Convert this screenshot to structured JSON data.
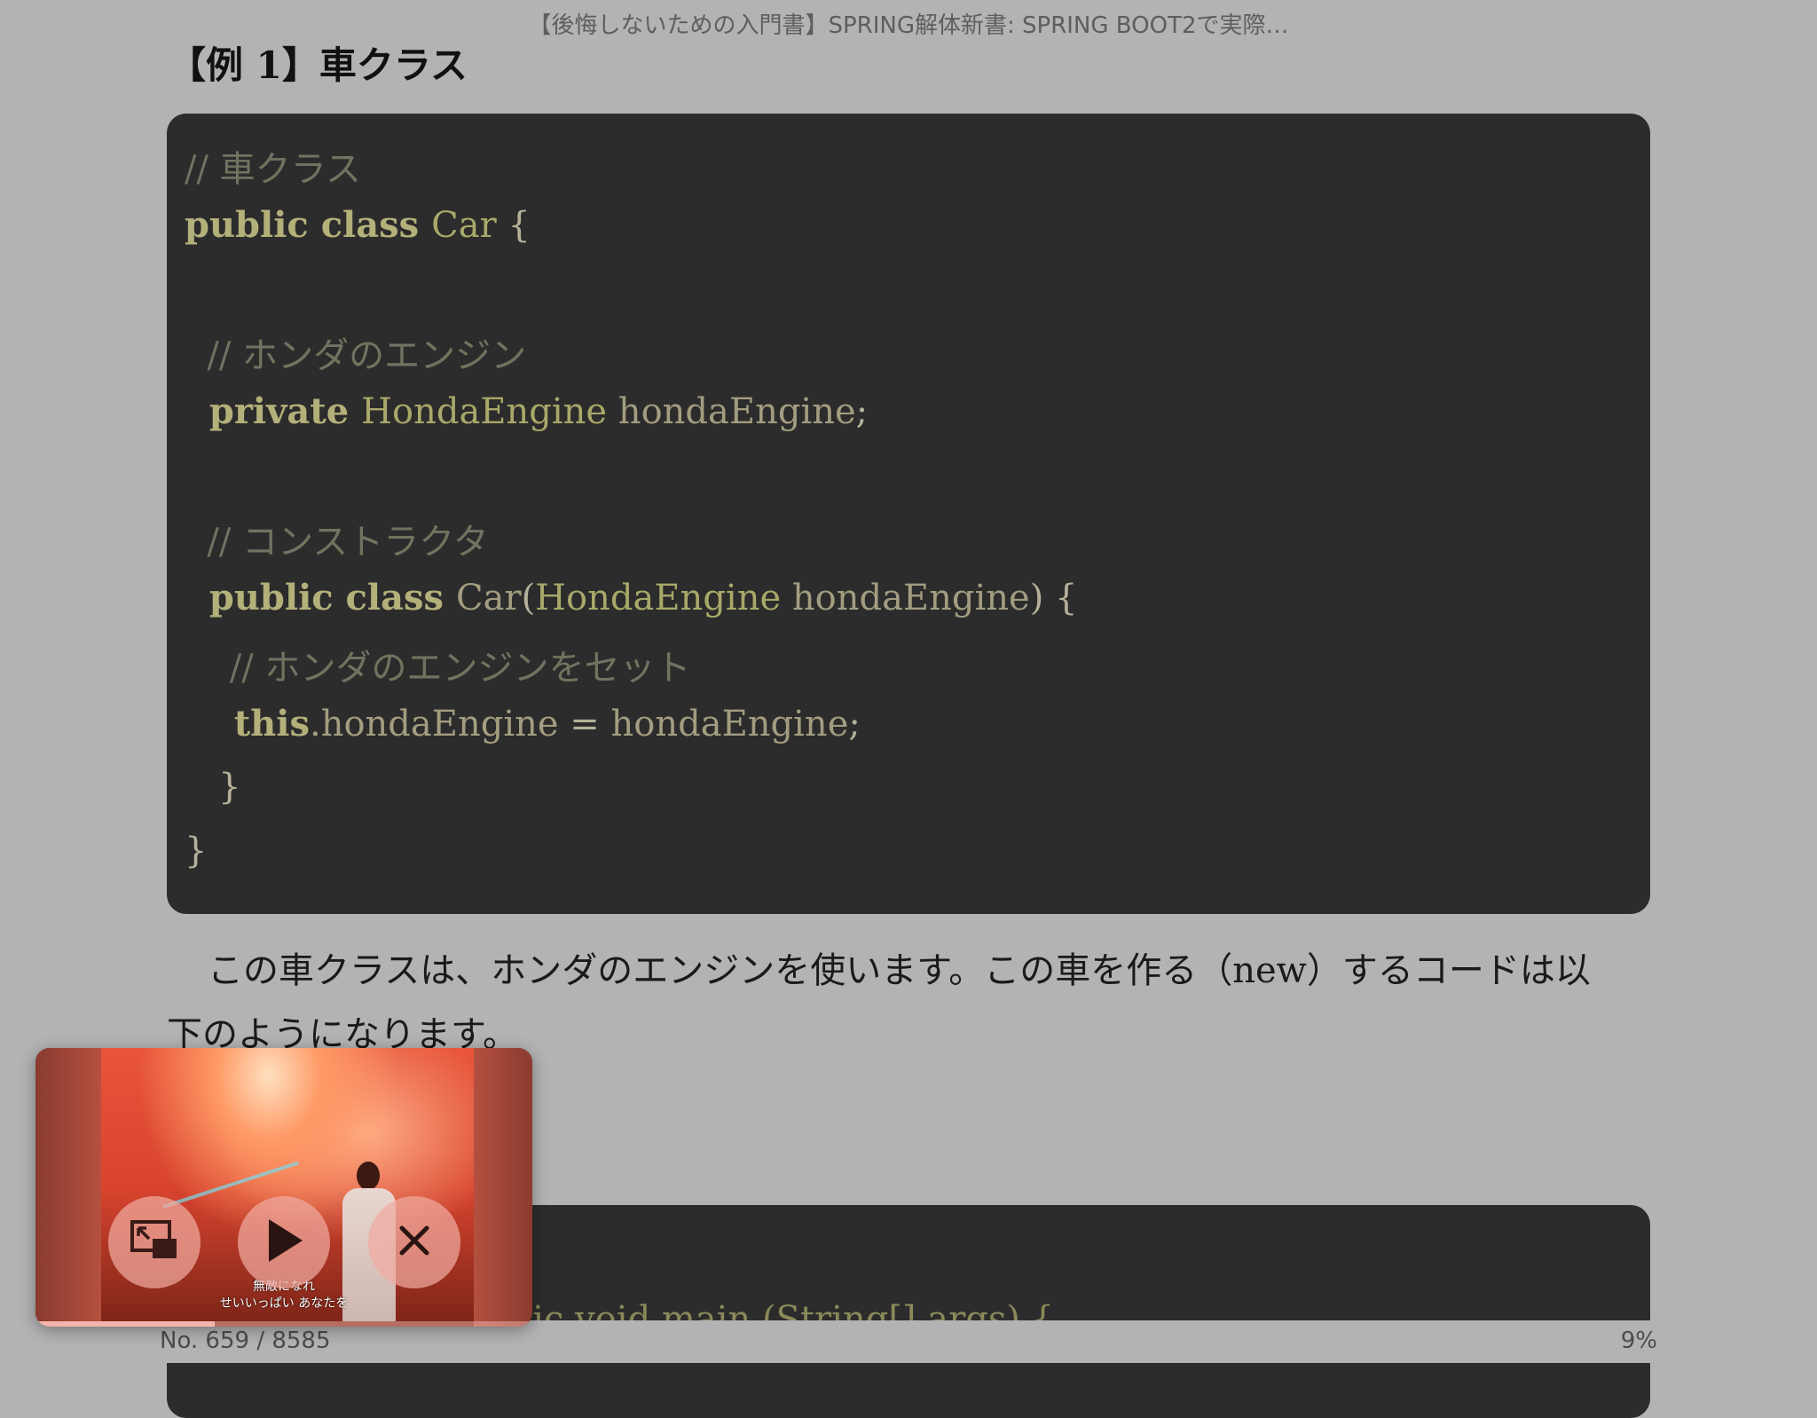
{
  "header": {
    "book_title": "【後悔しないための入門書】SPRING解体新書: SPRING BOOT2で実際…"
  },
  "section": {
    "heading": "【例 1】車クラス"
  },
  "code_block": {
    "lines": [
      [
        {
          "t": "// 車クラス",
          "c": "comment"
        }
      ],
      [
        {
          "t": "public class ",
          "c": "kw"
        },
        {
          "t": "Car",
          "c": "type"
        },
        {
          "t": " {",
          "c": "punc"
        }
      ],
      [],
      [
        {
          "t": "  // ホンダのエンジン",
          "c": "comment"
        }
      ],
      [
        {
          "t": "  private ",
          "c": "kw"
        },
        {
          "t": "HondaEngine",
          "c": "type"
        },
        {
          "t": " hondaEngine",
          "c": "ident"
        },
        {
          "t": ";",
          "c": "punc"
        }
      ],
      [],
      [
        {
          "t": "  // コンストラクタ",
          "c": "comment"
        }
      ],
      [
        {
          "t": "  public class ",
          "c": "kw"
        },
        {
          "t": "Car",
          "c": "ident"
        },
        {
          "t": "(",
          "c": "punc"
        },
        {
          "t": "HondaEngine",
          "c": "type"
        },
        {
          "t": " hondaEngine",
          "c": "ident"
        },
        {
          "t": ") {",
          "c": "punc"
        }
      ],
      [
        {
          "t": "    // ホンダのエンジンをセット",
          "c": "comment"
        }
      ],
      [
        {
          "t": "    this",
          "c": "kw"
        },
        {
          "t": ".hondaEngine",
          "c": "ident"
        },
        {
          "t": " = ",
          "c": "punc"
        },
        {
          "t": "hondaEngine",
          "c": "ident"
        },
        {
          "t": ";",
          "c": "punc"
        }
      ],
      [
        {
          "t": "   }",
          "c": "punc"
        }
      ],
      [
        {
          "t": "}",
          "c": "punc"
        }
      ]
    ]
  },
  "paragraph": {
    "line1": "この車クラスは、ホンダのエンジンを使います。この車を作る（new）するコードは以",
    "line2": "下のようになります。"
  },
  "code_block_2": {
    "partial_line": "public static void main (String[] args) {"
  },
  "footer": {
    "location": "No. 659 / 8585",
    "percent": "9%"
  },
  "pip": {
    "subtitle_line1": "無敵になれ",
    "subtitle_line2": "せいいっぱい あなたを",
    "progress": 0.36,
    "buttons": {
      "restore_icon": "restore-window-icon",
      "play_icon": "play-icon",
      "close_icon": "close-icon"
    }
  },
  "colors": {
    "background": "#b3b3b3",
    "code_bg": "#2c2c2c"
  }
}
